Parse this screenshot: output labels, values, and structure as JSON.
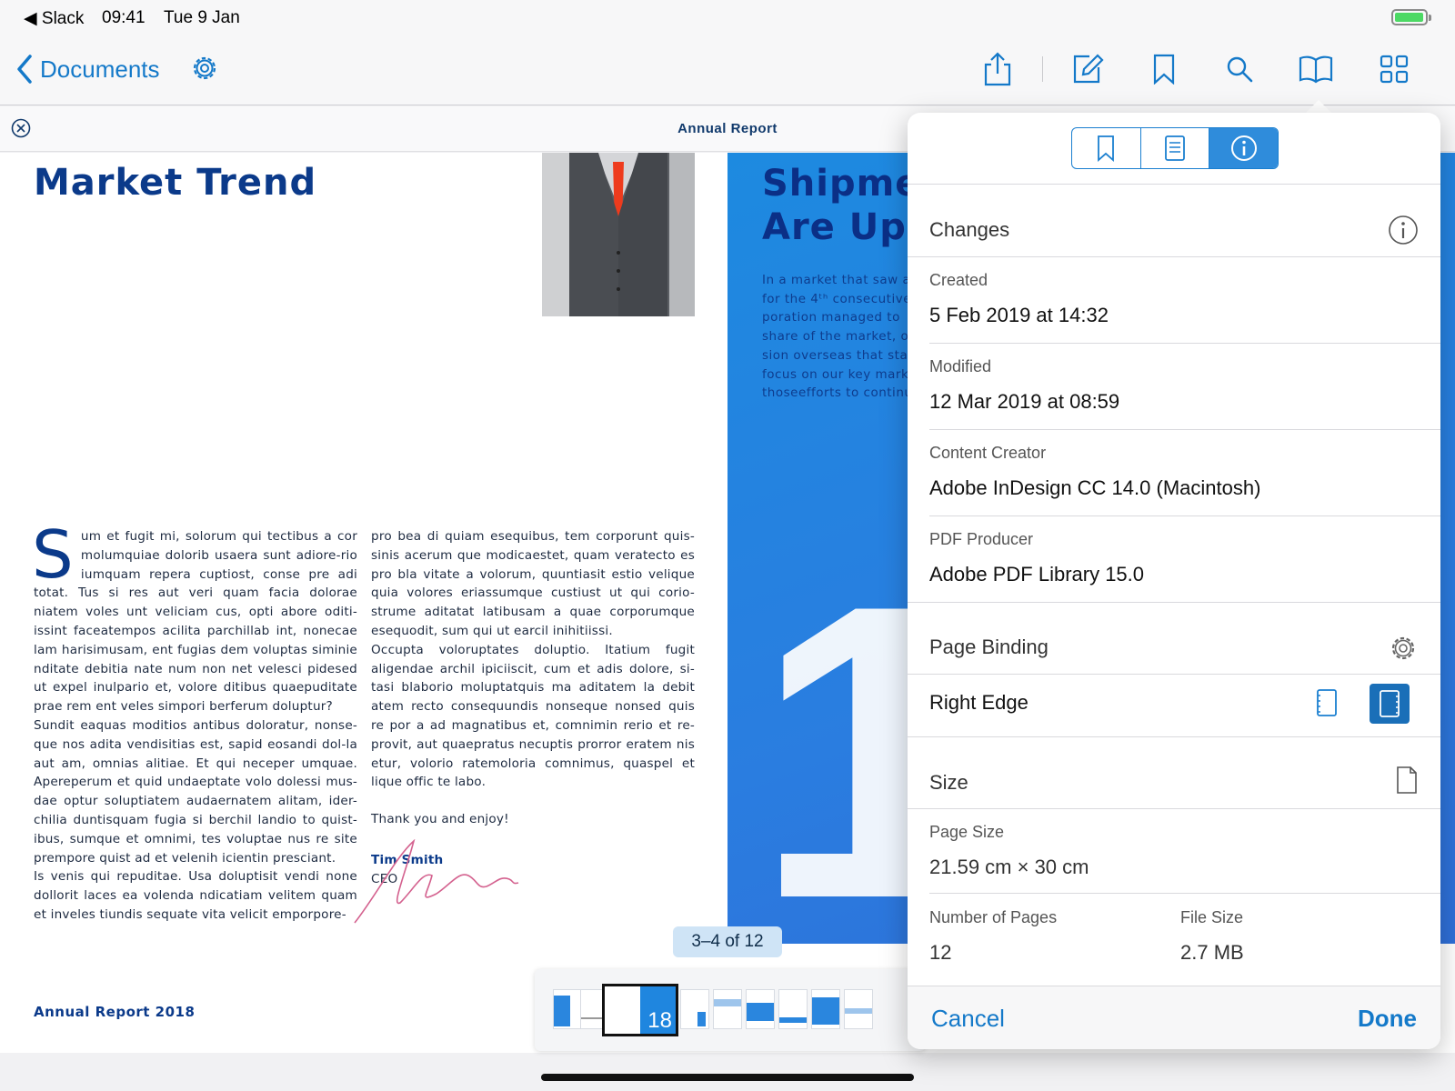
{
  "status_bar": {
    "back_app": "◀ Slack",
    "time": "09:41",
    "date": "Tue 9 Jan"
  },
  "nav": {
    "back_label": "Documents",
    "icons": [
      "gear-icon",
      "share-icon",
      "edit-icon",
      "bookmark-icon",
      "search-icon",
      "book-icon",
      "grid-icon"
    ]
  },
  "document": {
    "title": "Annual Report",
    "page_left": {
      "headline": "Market Trend",
      "dropcap": "S",
      "col1": [
        "um et fugit mi, solorum qui tectibus a cor molumquiae dolorib usaera sunt adiore-rio iumquam repera cuptiost, conse pre adi totat. Tus si res aut veri quam facia dolorae niatem voles unt veliciam cus, opti abore oditi-issint faceatempos acilita parchillab int, nonecae lam harisimusam, ent fugias dem voluptas siminie nditate debitia nate num non net velesci pidesed ut expel inulpario et, volore ditibus quaepuditate prae rem ent veles simpori berferum doluptur?",
        "Sundit eaquas moditios antibus doloratur, nonse-que nos adita vendisitias est, sapid eosandi dol-la aut am, omnias alitiae. Et qui neceper umquae. Apereperum et quid undaeptate volo dolessi mus-dae optur soluptiatem audaernatem alitam, ider-chilia duntisquam fugia si berchil landio to quist-ibus, sumque et omnimi, tes voluptae nus re site prempore quist ad et velenih icientin presciant.",
        "Is venis qui repuditae. Usa doluptisit vendi none dollorit laces ea volenda ndicatiam velitem quam et inveles tiundis sequate vita velicit emporpore-"
      ],
      "col2": [
        "pro bea di quiam esequibus, tem corporunt quis-sinis acerum que modicaestet, quam veratecto es pro bla vitate a volorum, quuntiasit estio velique quia volores eriassumque custiust ut qui corio-strume aditatat latibusam a quae corporumque esequodit, sum qui ut earcil inihitiissi.",
        "Occupta voloruptates doluptio. Itatium fugit aligendae archil ipiciiscit, cum et adis dolore, si-tasi blaborio moluptatquis ma aditatem la debit atem recto consequundis nonseque nonsed quis re por a ad magnatibus et, comnimin rerio et re-provit, aut quaepratus necuptis prorror eratem nis etur, volorio ratemoloria comnimus, quaspel et lique offic te labo."
      ],
      "closing": "Thank you and enjoy!",
      "signer_name": "Tim Smith",
      "signer_title": "CEO",
      "footer": "Annual Report 2018"
    },
    "page_right": {
      "headline_line1": "Shipmer",
      "headline_line2": "Are Up!",
      "intro_lines": [
        "In a market that saw a",
        "for the 4ᵗʰ consecutive",
        "poration managed to",
        "share of the market, o",
        "sion overseas that sta",
        "focus on our key mark",
        "thoseefforts to continu"
      ],
      "big_number": "1"
    }
  },
  "page_counter": "3–4 of 12",
  "thumbnails": {
    "current_label": "18",
    "count": 9
  },
  "info_panel": {
    "tabs": [
      "bookmark-outline-icon",
      "page-list-icon",
      "info-icon"
    ],
    "active_tab": "info",
    "changes": {
      "title": "Changes",
      "created_label": "Created",
      "created_value": "5 Feb 2019 at 14:32",
      "modified_label": "Modified",
      "modified_value": "12 Mar 2019 at 08:59",
      "creator_label": "Content Creator",
      "creator_value": "Adobe InDesign CC 14.0 (Macintosh)",
      "producer_label": "PDF Producer",
      "producer_value": "Adobe PDF Library 15.0"
    },
    "binding": {
      "title": "Page Binding",
      "value": "Right Edge",
      "selected": "right"
    },
    "size": {
      "title": "Size",
      "page_size_label": "Page Size",
      "page_size_value": "21.59 cm × 30 cm",
      "pages_label": "Number of Pages",
      "pages_value": "12",
      "file_size_label": "File Size",
      "file_size_value": "2.7 MB"
    },
    "cancel_label": "Cancel",
    "done_label": "Done"
  },
  "colors": {
    "accent": "#1479c9",
    "brand_dark": "#0b3a8a",
    "page_blue": "#2a7de0",
    "battery": "#4cd964"
  }
}
